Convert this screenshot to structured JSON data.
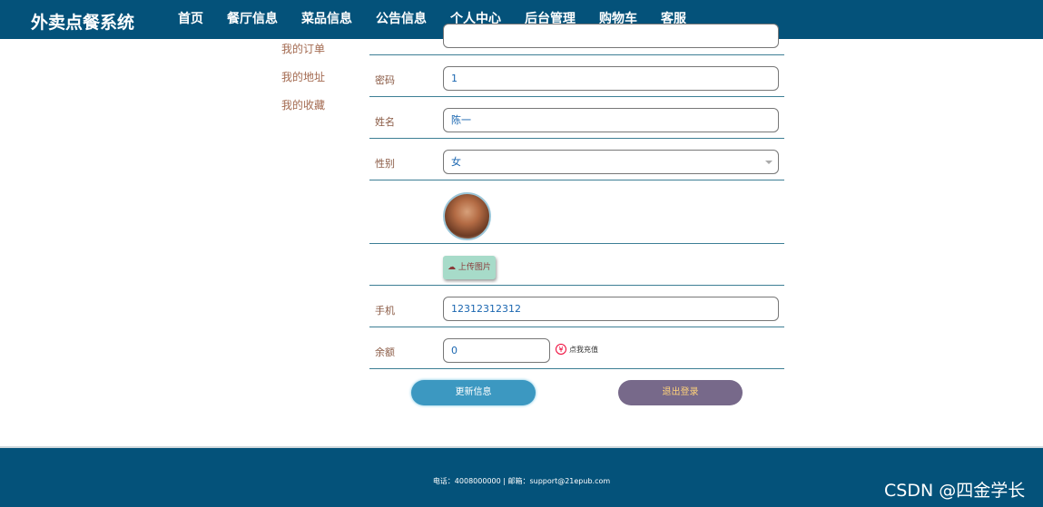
{
  "header": {
    "brand": "外卖点餐系统",
    "nav": [
      "首页",
      "餐厅信息",
      "菜品信息",
      "公告信息",
      "个人中心",
      "后台管理",
      "购物车",
      "客服"
    ],
    "active": "个人中心"
  },
  "sidebar": {
    "items": [
      "我的订单",
      "我的地址",
      "我的收藏"
    ]
  },
  "form": {
    "password_label": "密码",
    "password_value": "1",
    "name_label": "姓名",
    "name_value": "陈一",
    "gender_label": "性别",
    "gender_value": "女",
    "upload_label": "上传图片",
    "phone_label": "手机",
    "phone_value": "12312312312",
    "balance_label": "余额",
    "balance_value": "0",
    "yuan_symbol": "¥",
    "recharge_label": "点我充值"
  },
  "buttons": {
    "update": "更新信息",
    "logout": "退出登录"
  },
  "footer": {
    "text": "电话：4008000000 | 邮箱：support@21epub.com"
  },
  "watermark": "CSDN @四金学长",
  "colors": {
    "primary": "#04527a",
    "update_button": "#3c98c1",
    "logout_button": "#77698a"
  }
}
